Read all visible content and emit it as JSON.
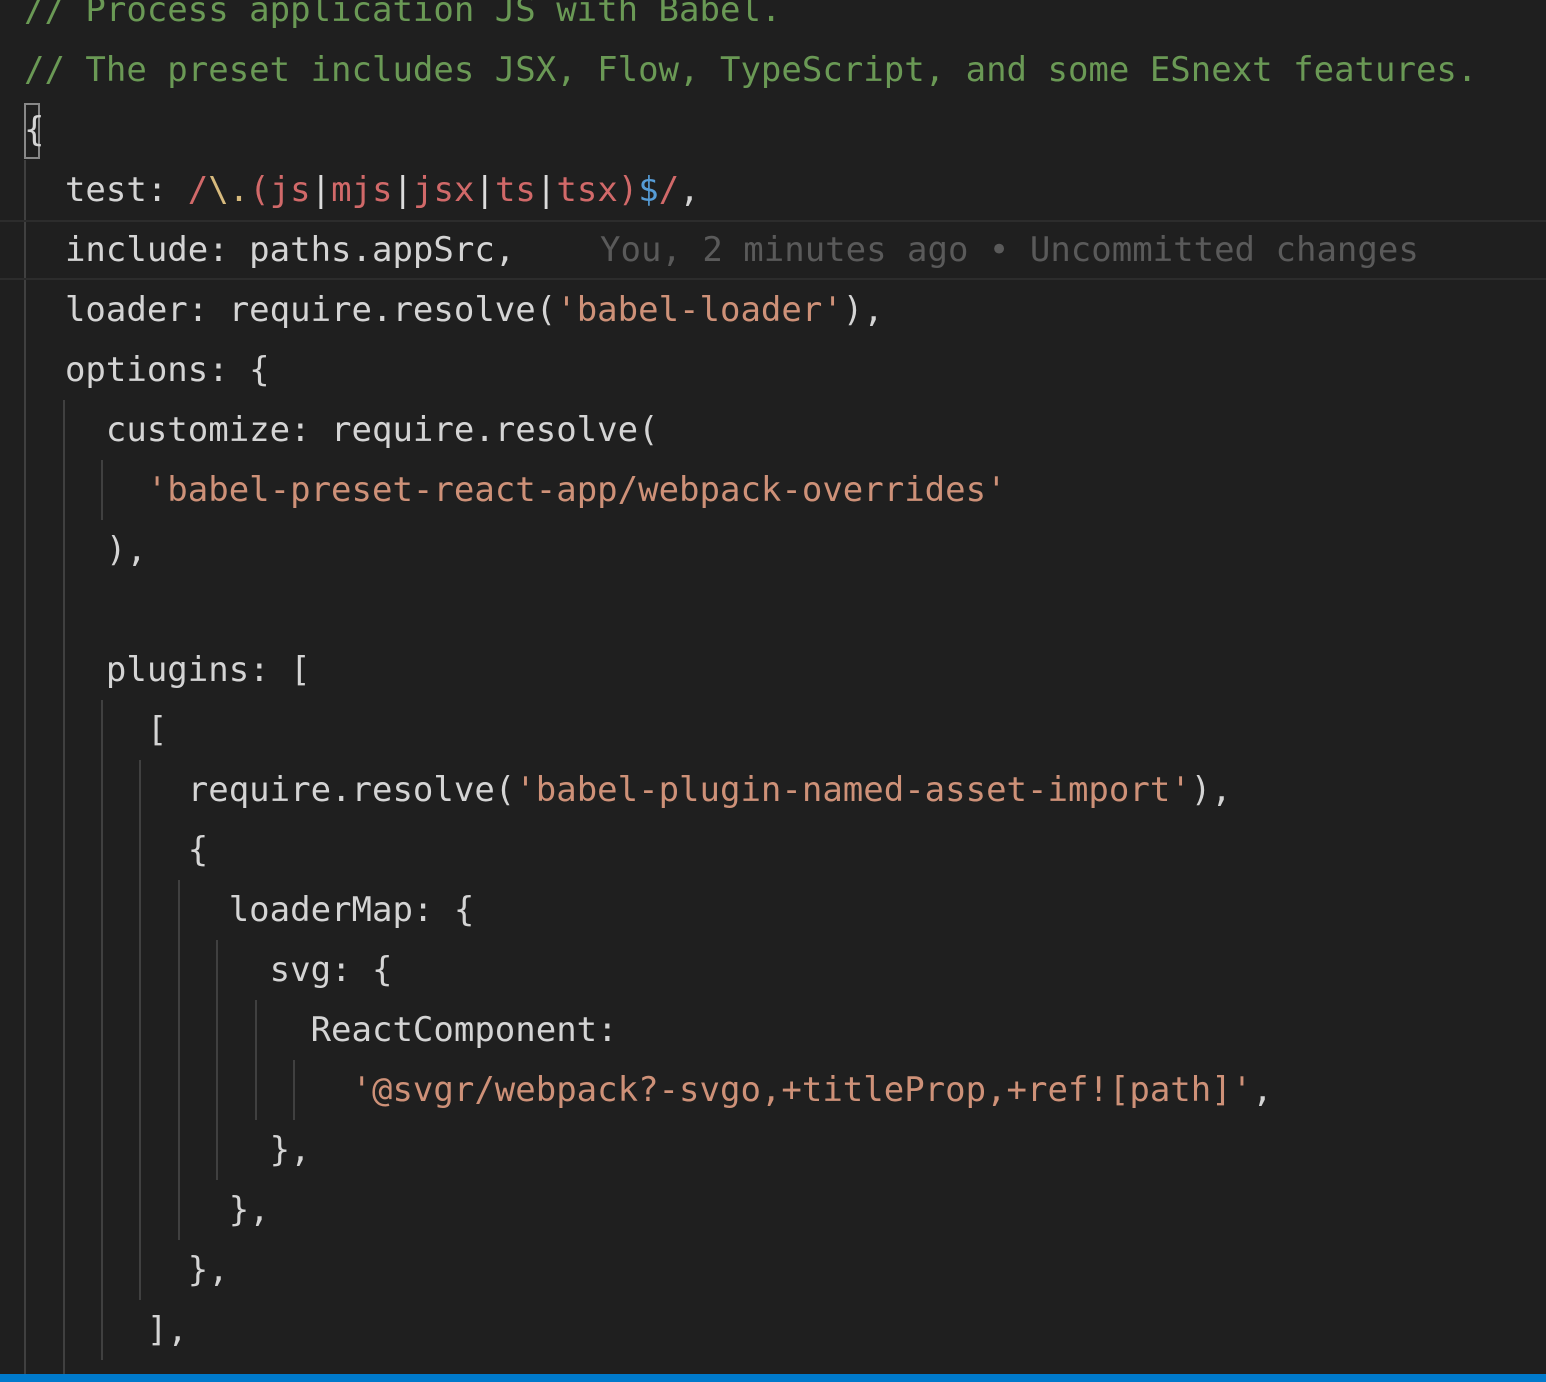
{
  "editor": {
    "lines": [
      {
        "segments": [
          {
            "text": "// Process application JS with Babel.",
            "kind": "comment"
          }
        ]
      },
      {
        "segments": [
          {
            "text": "// The preset includes JSX, Flow, TypeScript, and some ESnext features.",
            "kind": "comment"
          }
        ]
      },
      {
        "segments": [
          {
            "text": "{",
            "kind": "text"
          }
        ]
      },
      {
        "segments": [
          {
            "text": "  test: ",
            "kind": "text"
          },
          {
            "text": "/",
            "kind": "regex"
          },
          {
            "text": "\\.",
            "kind": "esc"
          },
          {
            "text": "(",
            "kind": "regex"
          },
          {
            "text": "js",
            "kind": "regex"
          },
          {
            "text": "|",
            "kind": "op"
          },
          {
            "text": "mjs",
            "kind": "regex"
          },
          {
            "text": "|",
            "kind": "op"
          },
          {
            "text": "jsx",
            "kind": "regex"
          },
          {
            "text": "|",
            "kind": "op"
          },
          {
            "text": "ts",
            "kind": "regex"
          },
          {
            "text": "|",
            "kind": "op"
          },
          {
            "text": "tsx",
            "kind": "regex"
          },
          {
            "text": ")",
            "kind": "regex"
          },
          {
            "text": "$",
            "kind": "anchor"
          },
          {
            "text": "/",
            "kind": "regex"
          },
          {
            "text": ",",
            "kind": "text"
          }
        ]
      },
      {
        "segments": [
          {
            "text": "  include: paths.appSrc,",
            "kind": "text"
          }
        ],
        "current": true,
        "blame": "You, 2 minutes ago • Uncommitted changes"
      },
      {
        "segments": [
          {
            "text": "  loader: require.resolve(",
            "kind": "text"
          },
          {
            "text": "'babel-loader'",
            "kind": "str"
          },
          {
            "text": "),",
            "kind": "text"
          }
        ]
      },
      {
        "segments": [
          {
            "text": "  options: {",
            "kind": "text"
          }
        ]
      },
      {
        "segments": [
          {
            "text": "    customize: require.resolve(",
            "kind": "text"
          }
        ]
      },
      {
        "segments": [
          {
            "text": "      ",
            "kind": "text"
          },
          {
            "text": "'babel-preset-react-app/webpack-overrides'",
            "kind": "str"
          }
        ]
      },
      {
        "segments": [
          {
            "text": "    ),",
            "kind": "text"
          }
        ]
      },
      {
        "segments": [
          {
            "text": "",
            "kind": "text"
          }
        ]
      },
      {
        "segments": [
          {
            "text": "    plugins: [",
            "kind": "text"
          }
        ]
      },
      {
        "segments": [
          {
            "text": "      [",
            "kind": "text"
          }
        ]
      },
      {
        "segments": [
          {
            "text": "        require.resolve(",
            "kind": "text"
          },
          {
            "text": "'babel-plugin-named-asset-import'",
            "kind": "str"
          },
          {
            "text": "),",
            "kind": "text"
          }
        ]
      },
      {
        "segments": [
          {
            "text": "        {",
            "kind": "text"
          }
        ]
      },
      {
        "segments": [
          {
            "text": "          loaderMap: {",
            "kind": "text"
          }
        ]
      },
      {
        "segments": [
          {
            "text": "            svg: {",
            "kind": "text"
          }
        ]
      },
      {
        "segments": [
          {
            "text": "              ReactComponent:",
            "kind": "text"
          }
        ]
      },
      {
        "segments": [
          {
            "text": "                ",
            "kind": "text"
          },
          {
            "text": "'@svgr/webpack?-svgo,+titleProp,+ref![path]'",
            "kind": "str"
          },
          {
            "text": ",",
            "kind": "text"
          }
        ]
      },
      {
        "segments": [
          {
            "text": "            },",
            "kind": "text"
          }
        ]
      },
      {
        "segments": [
          {
            "text": "          },",
            "kind": "text"
          }
        ]
      },
      {
        "segments": [
          {
            "text": "        },",
            "kind": "text"
          }
        ]
      },
      {
        "segments": [
          {
            "text": "      ],",
            "kind": "text"
          }
        ]
      }
    ]
  },
  "colors": {
    "background": "#1f1f1f",
    "comment": "#6a9955",
    "string": "#ce9178",
    "regex": "#d16969",
    "anchor": "#569cd6",
    "text": "#d4d4d4",
    "blame": "#5a5a5a",
    "statusbar": "#007acc"
  }
}
